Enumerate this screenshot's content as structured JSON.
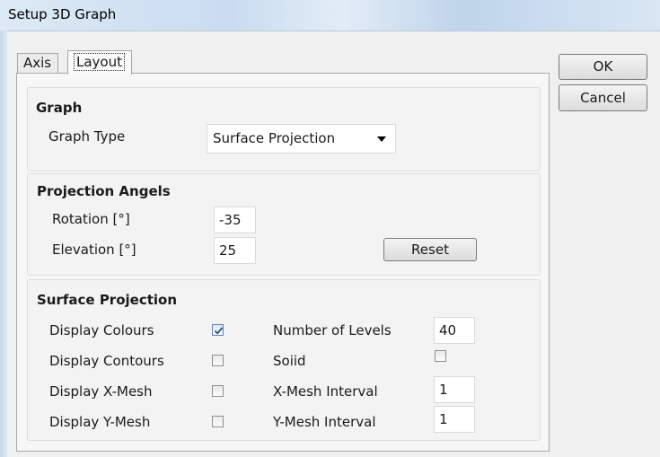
{
  "window": {
    "title": "Setup 3D Graph"
  },
  "tabs": [
    {
      "label": "Axis"
    },
    {
      "label": "Layout"
    }
  ],
  "buttons": {
    "ok": "OK",
    "cancel": "Cancel",
    "reset": "Reset"
  },
  "graph": {
    "heading": "Graph",
    "type_label": "Graph Type",
    "type_value": "Surface Projection"
  },
  "projection": {
    "heading": "Projection Angels",
    "rotation_label": "Rotation [°]",
    "rotation_value": "-35",
    "elevation_label": "Elevation [°]",
    "elevation_value": "25"
  },
  "surface": {
    "heading": "Surface Projection",
    "display_colours": {
      "label": "Display Colours",
      "checked": true
    },
    "display_contours": {
      "label": "Display Contours",
      "checked": false
    },
    "display_xmesh": {
      "label": "Display X-Mesh",
      "checked": false
    },
    "display_ymesh": {
      "label": "Display Y-Mesh",
      "checked": false
    },
    "levels_label": "Number of Levels",
    "levels_value": "40",
    "solid": {
      "label": "Soiid",
      "checked": false
    },
    "xmesh_interval_label": "X-Mesh Interval",
    "xmesh_interval_value": "1",
    "ymesh_interval_label": "Y-Mesh Interval",
    "ymesh_interval_value": "1"
  }
}
